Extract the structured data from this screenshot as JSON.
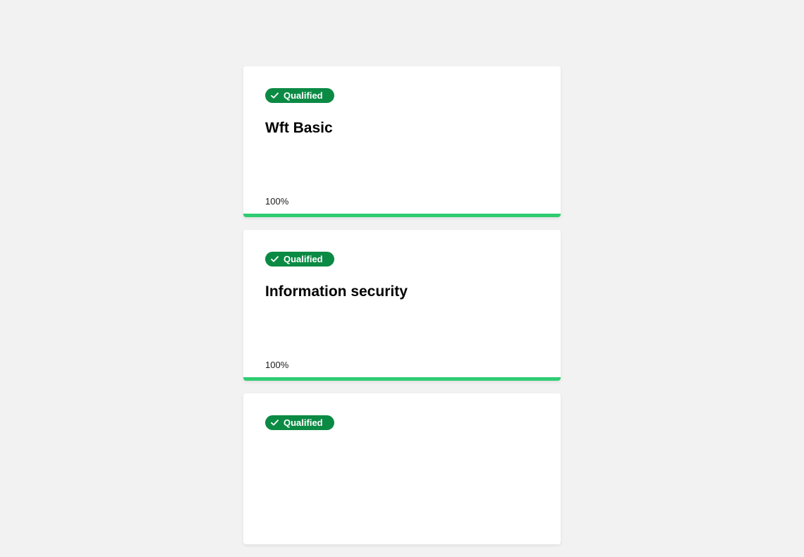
{
  "courses": [
    {
      "status": "Qualified",
      "title": "Wft Basic",
      "progress_label": "100%",
      "progress": 1.0
    },
    {
      "status": "Qualified",
      "title": "Information security",
      "progress_label": "100%",
      "progress": 1.0
    },
    {
      "status": "Qualified",
      "title": "",
      "progress_label": "",
      "progress": null
    }
  ],
  "colors": {
    "badge": "#0b8a44",
    "progress": "#2ecc71",
    "background": "#f2f2f2"
  },
  "icons": {
    "badge": "checkmark-icon"
  }
}
